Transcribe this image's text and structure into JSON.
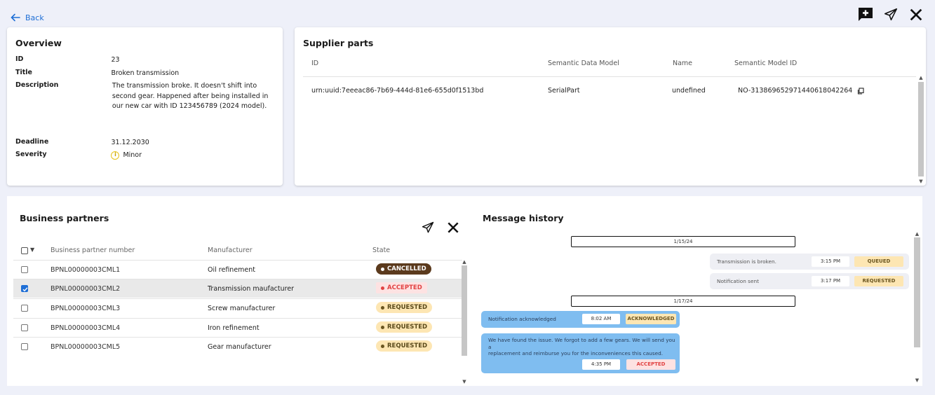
{
  "nav": {
    "back_label": "Back"
  },
  "top_actions": {
    "add": "add-comment-icon",
    "send": "send-icon",
    "close": "close-icon"
  },
  "overview": {
    "title": "Overview",
    "fields": {
      "id_label": "ID",
      "id_value": "23",
      "title_label": "Title",
      "title_value": "Broken transmission",
      "desc_label": "Description",
      "desc_value": "The transmission broke. It doesn't shift into second gear. Happened after being installed in our new car with ID 123456789 (2024 model).",
      "deadline_label": "Deadline",
      "deadline_value": "31.12.2030",
      "severity_label": "Severity",
      "severity_value": "Minor"
    }
  },
  "supplier_parts": {
    "title": "Supplier parts",
    "columns": [
      "ID",
      "Semantic Data Model",
      "Name",
      "Semantic Model ID"
    ],
    "rows": [
      {
        "id": "urn:uuid:7eeeac86-7b69-444d-81e6-655d0f1513bd",
        "model": "SerialPart",
        "name": "undefined",
        "model_id": "NO-313869652971440618042264"
      }
    ]
  },
  "business_partners": {
    "title": "Business partners",
    "columns": [
      "Business partner number",
      "Manufacturer",
      "State"
    ],
    "rows": [
      {
        "number": "BPNL00000003CML1",
        "manufacturer": "Oil refinement",
        "state": "CANCELLED",
        "checked": false
      },
      {
        "number": "BPNL00000003CML2",
        "manufacturer": "Transmission maufacturer",
        "state": "ACCEPTED",
        "checked": true
      },
      {
        "number": "BPNL00000003CML3",
        "manufacturer": "Screw manufacturer",
        "state": "REQUESTED",
        "checked": false
      },
      {
        "number": "BPNL00000003CML4",
        "manufacturer": "Iron refinement",
        "state": "REQUESTED",
        "checked": false
      },
      {
        "number": "BPNL00000003CML5",
        "manufacturer": "Gear manufacturer",
        "state": "REQUESTED",
        "checked": false
      }
    ]
  },
  "message_history": {
    "title": "Message history",
    "dates": [
      "1/15/24",
      "1/17/24"
    ],
    "messages": [
      {
        "text": "Transmission is broken.",
        "time": "3:15 PM",
        "status": "QUEUED"
      },
      {
        "text": "Notification sent",
        "time": "3:17 PM",
        "status": "REQUESTED"
      },
      {
        "text": "Notification acknowledged",
        "time": "8:02 AM",
        "status": "ACKNOWLEDGED"
      },
      {
        "text_line1": "We have found the issue. We forgot to add a few gears. We will send you a",
        "text_line2": "replacement and reimburse you for the inconveniences this caused.",
        "time": "4:35 PM",
        "status": "ACCEPTED"
      }
    ]
  },
  "colors": {
    "accent": "#1f6fd6",
    "cancelled": "#5b3a1d",
    "accepted": "#e14343",
    "requested": "#fde6b3",
    "incoming": "#7fbdf0"
  }
}
